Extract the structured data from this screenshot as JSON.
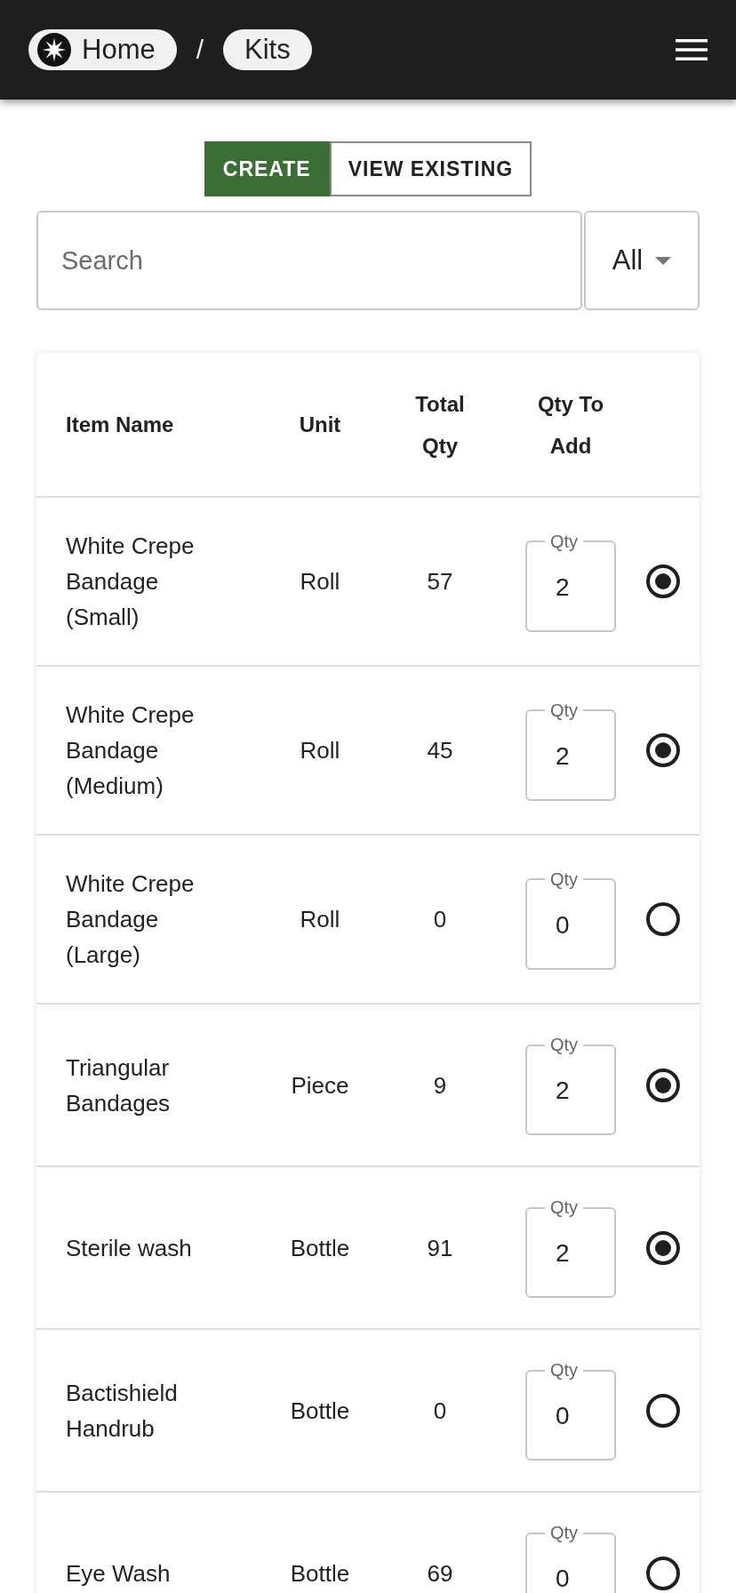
{
  "header": {
    "breadcrumbs": [
      {
        "label": "Home",
        "kind": "home"
      },
      {
        "label": "Kits",
        "kind": "plain"
      }
    ],
    "separator": "/"
  },
  "mode_tabs": [
    {
      "label": "CREATE",
      "selected": true
    },
    {
      "label": "VIEW EXISTING",
      "selected": false
    }
  ],
  "search": {
    "placeholder": "Search"
  },
  "filter": {
    "value": "All"
  },
  "table": {
    "columns": [
      "Item Name",
      "Unit",
      "Total Qty",
      "Qty To Add"
    ],
    "rows": [
      {
        "name": "White Crepe Bandage (Small)",
        "unit": "Roll",
        "total_qty": "57",
        "qty_label": "Qty",
        "qty": "2",
        "selected": true
      },
      {
        "name": "White Crepe Bandage (Medium)",
        "unit": "Roll",
        "total_qty": "45",
        "qty_label": "Qty",
        "qty": "2",
        "selected": true
      },
      {
        "name": "White Crepe Bandage (Large)",
        "unit": "Roll",
        "total_qty": "0",
        "qty_label": "Qty",
        "qty": "0",
        "selected": false
      },
      {
        "name": "Triangular Bandages",
        "unit": "Piece",
        "total_qty": "9",
        "qty_label": "Qty",
        "qty": "2",
        "selected": true
      },
      {
        "name": "Sterile wash",
        "unit": "Bottle",
        "total_qty": "91",
        "qty_label": "Qty",
        "qty": "2",
        "selected": true
      },
      {
        "name": "Bactishield Handrub",
        "unit": "Bottle",
        "total_qty": "0",
        "qty_label": "Qty",
        "qty": "0",
        "selected": false
      },
      {
        "name": "Eye Wash",
        "unit": "Bottle",
        "total_qty": "69",
        "qty_label": "Qty",
        "qty": "0",
        "selected": false
      }
    ]
  }
}
